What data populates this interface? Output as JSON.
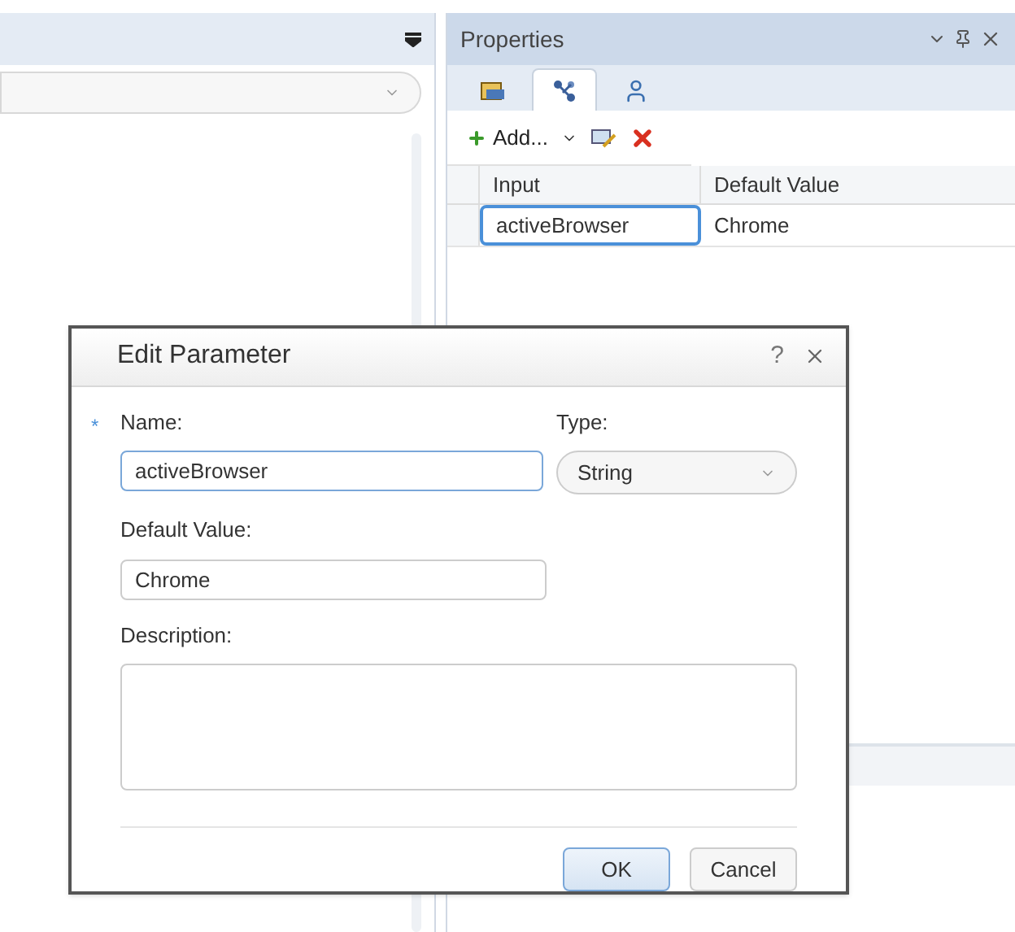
{
  "properties": {
    "title": "Properties",
    "tabs": [
      {
        "kind": "form",
        "selected": false
      },
      {
        "kind": "params",
        "selected": true
      },
      {
        "kind": "user",
        "selected": false
      }
    ],
    "toolbar": {
      "add_label": "Add..."
    },
    "table": {
      "columns": [
        "Input",
        "Default Value"
      ],
      "rows": [
        {
          "input": "activeBrowser",
          "default_value": "Chrome",
          "selected": true
        }
      ]
    }
  },
  "dialog": {
    "title": "Edit Parameter",
    "help": "?",
    "name_label": "Name:",
    "name_required": true,
    "required_marker": "*",
    "name_value": "activeBrowser",
    "name_focused": true,
    "type_label": "Type:",
    "type_value": "String",
    "default_label": "Default Value:",
    "default_value": "Chrome",
    "description_label": "Description:",
    "buttons": [
      {
        "label": "OK",
        "primary": true
      },
      {
        "label": "Cancel",
        "primary": false
      }
    ]
  }
}
